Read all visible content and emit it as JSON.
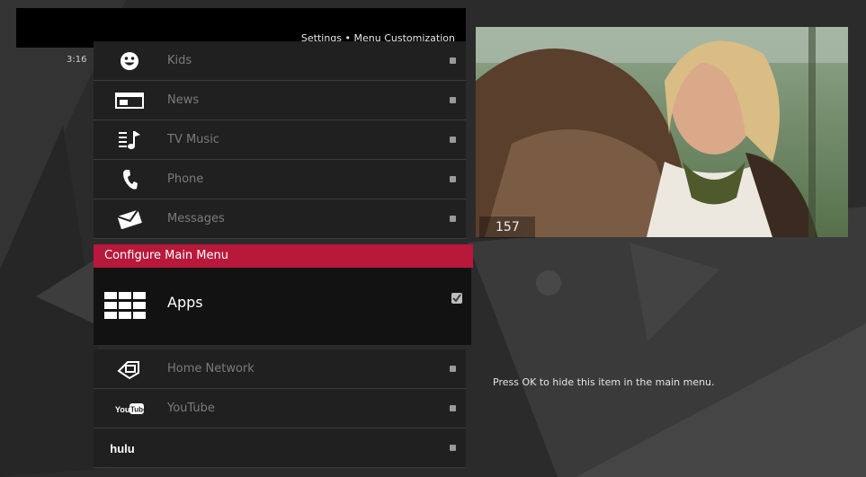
{
  "header": {
    "title": "Settings • Menu Customization"
  },
  "clock": "3:16",
  "menu_items_above": [
    {
      "icon": "smiley-icon",
      "label": "Kids"
    },
    {
      "icon": "news-window-icon",
      "label": "News"
    },
    {
      "icon": "music-note-icon",
      "label": "TV Music"
    },
    {
      "icon": "phone-icon",
      "label": "Phone"
    },
    {
      "icon": "envelope-icon",
      "label": "Messages"
    }
  ],
  "selected_section": {
    "title": "Configure Main Menu",
    "item": {
      "icon": "apps-grid-icon",
      "label": "Apps",
      "checked": true
    }
  },
  "menu_items_below": [
    {
      "icon": "home-network-icon",
      "label": "Home Network"
    },
    {
      "icon": "youtube-logo-icon",
      "label": "YouTube"
    },
    {
      "icon": "hulu-logo-icon",
      "label": "hulu"
    }
  ],
  "video": {
    "channel": "157"
  },
  "hint": "Press OK to hide this item in the main menu.",
  "colors": {
    "accent": "#b8183a",
    "row_bg": "#202020",
    "selected_bg": "#121212",
    "header_bg": "#000000",
    "background": "#2b2b2b"
  }
}
